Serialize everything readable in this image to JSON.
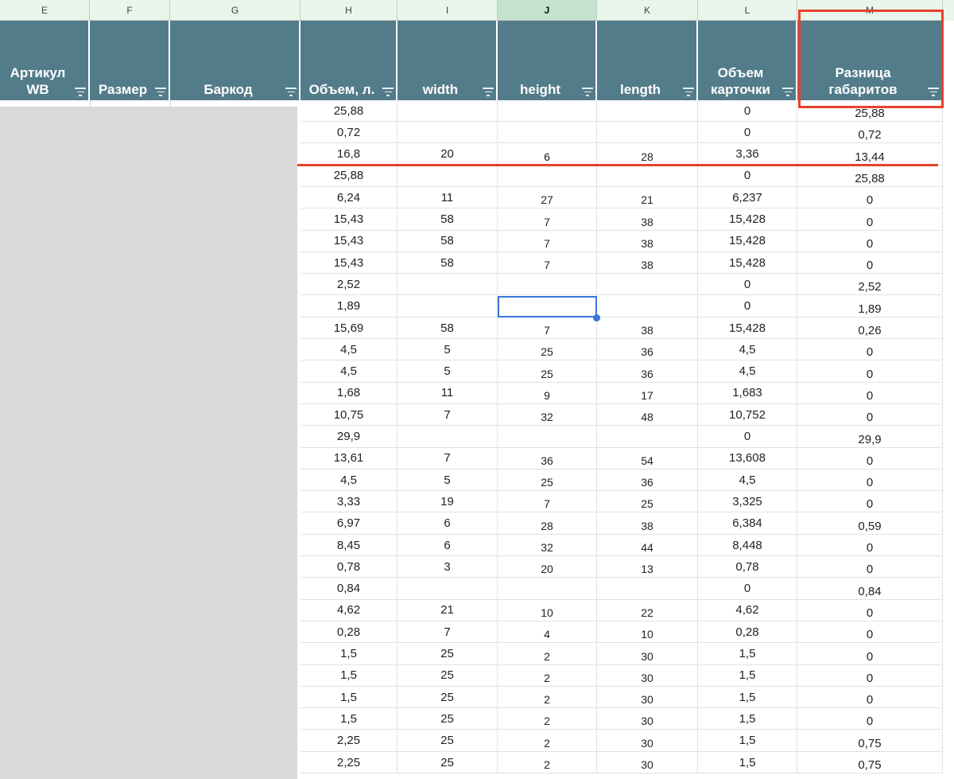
{
  "app": {
    "selected_column": "J"
  },
  "columns": [
    {
      "letter": "E",
      "header": "Артикул\nWB",
      "filter_icon": "filter-icon"
    },
    {
      "letter": "F",
      "header": "Размер",
      "filter_icon": "filter-icon"
    },
    {
      "letter": "G",
      "header": "Баркод",
      "filter_icon": "filter-icon"
    },
    {
      "letter": "H",
      "header": "Объем, л.",
      "filter_icon": "filter-icon"
    },
    {
      "letter": "I",
      "header": "width",
      "filter_icon": "filter-icon"
    },
    {
      "letter": "J",
      "header": "height",
      "filter_icon": "filter-icon"
    },
    {
      "letter": "K",
      "header": "length",
      "filter_icon": "filter-icon"
    },
    {
      "letter": "L",
      "header": "Объем\nкарточки",
      "filter_icon": "filter-icon"
    },
    {
      "letter": "M",
      "header": "Разница\nгабаритов",
      "filter_icon": "filter-icon"
    }
  ],
  "rows": [
    {
      "h": "25,88",
      "i": "",
      "j": "",
      "k": "",
      "l": "0",
      "m": "25,88"
    },
    {
      "h": "0,72",
      "i": "",
      "j": "",
      "k": "",
      "l": "0",
      "m": "0,72"
    },
    {
      "h": "16,8",
      "i": "20",
      "j": "6",
      "k": "28",
      "l": "3,36",
      "m": "13,44"
    },
    {
      "h": "25,88",
      "i": "",
      "j": "",
      "k": "",
      "l": "0",
      "m": "25,88"
    },
    {
      "h": "6,24",
      "i": "11",
      "j": "27",
      "k": "21",
      "l": "6,237",
      "m": "0"
    },
    {
      "h": "15,43",
      "i": "58",
      "j": "7",
      "k": "38",
      "l": "15,428",
      "m": "0"
    },
    {
      "h": "15,43",
      "i": "58",
      "j": "7",
      "k": "38",
      "l": "15,428",
      "m": "0"
    },
    {
      "h": "15,43",
      "i": "58",
      "j": "7",
      "k": "38",
      "l": "15,428",
      "m": "0"
    },
    {
      "h": "2,52",
      "i": "",
      "j": "",
      "k": "",
      "l": "0",
      "m": "2,52"
    },
    {
      "h": "1,89",
      "i": "",
      "j": "",
      "k": "",
      "l": "0",
      "m": "1,89"
    },
    {
      "h": "15,69",
      "i": "58",
      "j": "7",
      "k": "38",
      "l": "15,428",
      "m": "0,26"
    },
    {
      "h": "4,5",
      "i": "5",
      "j": "25",
      "k": "36",
      "l": "4,5",
      "m": "0"
    },
    {
      "h": "4,5",
      "i": "5",
      "j": "25",
      "k": "36",
      "l": "4,5",
      "m": "0"
    },
    {
      "h": "1,68",
      "i": "11",
      "j": "9",
      "k": "17",
      "l": "1,683",
      "m": "0"
    },
    {
      "h": "10,75",
      "i": "7",
      "j": "32",
      "k": "48",
      "l": "10,752",
      "m": "0"
    },
    {
      "h": "29,9",
      "i": "",
      "j": "",
      "k": "",
      "l": "0",
      "m": "29,9"
    },
    {
      "h": "13,61",
      "i": "7",
      "j": "36",
      "k": "54",
      "l": "13,608",
      "m": "0"
    },
    {
      "h": "4,5",
      "i": "5",
      "j": "25",
      "k": "36",
      "l": "4,5",
      "m": "0"
    },
    {
      "h": "3,33",
      "i": "19",
      "j": "7",
      "k": "25",
      "l": "3,325",
      "m": "0"
    },
    {
      "h": "6,97",
      "i": "6",
      "j": "28",
      "k": "38",
      "l": "6,384",
      "m": "0,59"
    },
    {
      "h": "8,45",
      "i": "6",
      "j": "32",
      "k": "44",
      "l": "8,448",
      "m": "0"
    },
    {
      "h": "0,78",
      "i": "3",
      "j": "20",
      "k": "13",
      "l": "0,78",
      "m": "0"
    },
    {
      "h": "0,84",
      "i": "",
      "j": "",
      "k": "",
      "l": "0",
      "m": "0,84"
    },
    {
      "h": "4,62",
      "i": "21",
      "j": "10",
      "k": "22",
      "l": "4,62",
      "m": "0"
    },
    {
      "h": "0,28",
      "i": "7",
      "j": "4",
      "k": "10",
      "l": "0,28",
      "m": "0"
    },
    {
      "h": "1,5",
      "i": "25",
      "j": "2",
      "k": "30",
      "l": "1,5",
      "m": "0"
    },
    {
      "h": "1,5",
      "i": "25",
      "j": "2",
      "k": "30",
      "l": "1,5",
      "m": "0"
    },
    {
      "h": "1,5",
      "i": "25",
      "j": "2",
      "k": "30",
      "l": "1,5",
      "m": "0"
    },
    {
      "h": "1,5",
      "i": "25",
      "j": "2",
      "k": "30",
      "l": "1,5",
      "m": "0"
    },
    {
      "h": "2,25",
      "i": "25",
      "j": "2",
      "k": "30",
      "l": "1,5",
      "m": "0,75"
    },
    {
      "h": "2,25",
      "i": "25",
      "j": "2",
      "k": "30",
      "l": "1,5",
      "m": "0,75"
    }
  ],
  "colors": {
    "header_bg": "#537c8a",
    "highlight_red": "#e8412c",
    "selection_blue": "#3b76d9",
    "grayed_area": "#d9d9d9"
  }
}
